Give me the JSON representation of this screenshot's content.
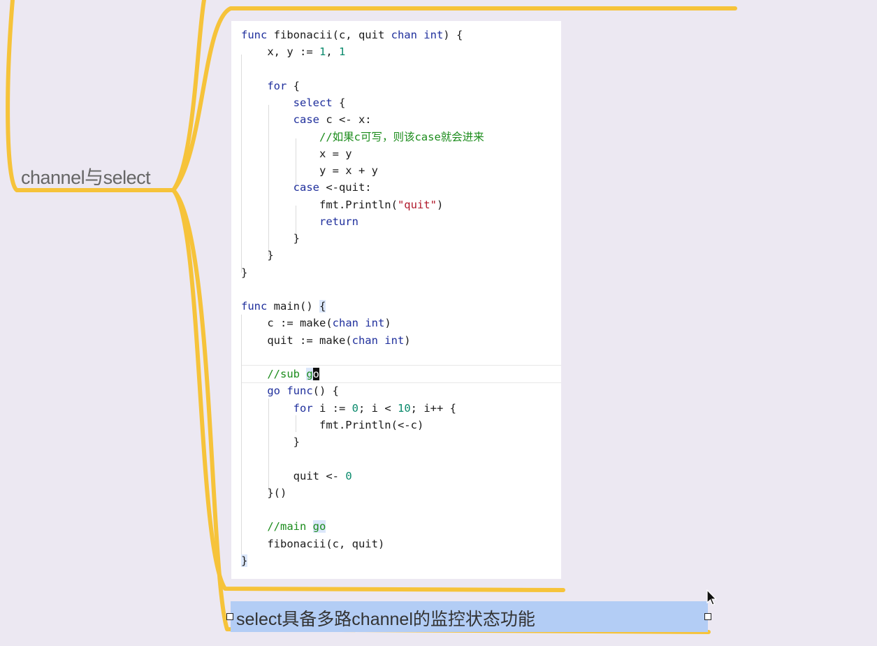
{
  "mindmap": {
    "root_label": "channel与select",
    "bottom_node_label": "select具备多路channel的监控状态功能",
    "branch_color": "#f6c33a"
  },
  "code": {
    "lines": [
      {
        "tokens": [
          {
            "k": "kw",
            "t": "func"
          },
          {
            "t": " fibonacii(c, quit "
          },
          {
            "k": "kw",
            "t": "chan int"
          },
          {
            "t": ") {"
          }
        ]
      },
      {
        "tokens": [
          {
            "t": "    x, y := "
          },
          {
            "k": "num",
            "t": "1"
          },
          {
            "t": ", "
          },
          {
            "k": "num",
            "t": "1"
          }
        ]
      },
      {
        "tokens": []
      },
      {
        "tokens": [
          {
            "t": "    "
          },
          {
            "k": "kw",
            "t": "for"
          },
          {
            "t": " {"
          }
        ]
      },
      {
        "tokens": [
          {
            "t": "        "
          },
          {
            "k": "kw",
            "t": "select"
          },
          {
            "t": " {"
          }
        ]
      },
      {
        "tokens": [
          {
            "t": "        "
          },
          {
            "k": "kw",
            "t": "case"
          },
          {
            "t": " c <- x:"
          }
        ]
      },
      {
        "tokens": [
          {
            "t": "            "
          },
          {
            "k": "cm",
            "t": "//如果c可写，则该case就会进来"
          }
        ]
      },
      {
        "tokens": [
          {
            "t": "            x = y"
          }
        ]
      },
      {
        "tokens": [
          {
            "t": "            y = x + y"
          }
        ]
      },
      {
        "tokens": [
          {
            "t": "        "
          },
          {
            "k": "kw",
            "t": "case"
          },
          {
            "t": " <-quit:"
          }
        ]
      },
      {
        "tokens": [
          {
            "t": "            fmt.Println("
          },
          {
            "k": "str",
            "t": "\"quit\""
          },
          {
            "t": ")"
          }
        ]
      },
      {
        "tokens": [
          {
            "t": "            "
          },
          {
            "k": "kw",
            "t": "return"
          }
        ]
      },
      {
        "tokens": [
          {
            "t": "        }"
          }
        ]
      },
      {
        "tokens": [
          {
            "t": "    }"
          }
        ]
      },
      {
        "tokens": [
          {
            "t": "}"
          }
        ]
      },
      {
        "tokens": []
      },
      {
        "tokens": [
          {
            "k": "kw",
            "t": "func"
          },
          {
            "t": " main() "
          },
          {
            "k": "hl",
            "t": "{"
          }
        ]
      },
      {
        "tokens": [
          {
            "t": "    c := make("
          },
          {
            "k": "kw",
            "t": "chan int"
          },
          {
            "t": ")"
          }
        ]
      },
      {
        "tokens": [
          {
            "t": "    quit := make("
          },
          {
            "k": "kw",
            "t": "chan int"
          },
          {
            "t": ")"
          }
        ]
      },
      {
        "tokens": []
      },
      {
        "tokens": [
          {
            "t": "    "
          },
          {
            "k": "cm",
            "t": "//sub "
          },
          {
            "k": "cm hl",
            "t": "g"
          },
          {
            "k": "cur",
            "t": "o"
          }
        ]
      },
      {
        "tokens": [
          {
            "t": "    "
          },
          {
            "k": "kw",
            "t": "go"
          },
          {
            "t": " "
          },
          {
            "k": "kw",
            "t": "func"
          },
          {
            "t": "() {"
          }
        ]
      },
      {
        "tokens": [
          {
            "t": "        "
          },
          {
            "k": "kw",
            "t": "for"
          },
          {
            "t": " i := "
          },
          {
            "k": "num",
            "t": "0"
          },
          {
            "t": "; i < "
          },
          {
            "k": "num",
            "t": "10"
          },
          {
            "t": "; i++ {"
          }
        ]
      },
      {
        "tokens": [
          {
            "t": "            fmt.Println(<-c)"
          }
        ]
      },
      {
        "tokens": [
          {
            "t": "        }"
          }
        ]
      },
      {
        "tokens": []
      },
      {
        "tokens": [
          {
            "t": "        quit <- "
          },
          {
            "k": "num",
            "t": "0"
          }
        ]
      },
      {
        "tokens": [
          {
            "t": "    }()"
          }
        ]
      },
      {
        "tokens": []
      },
      {
        "tokens": [
          {
            "t": "    "
          },
          {
            "k": "cm",
            "t": "//main "
          },
          {
            "k": "cm hl",
            "t": "go"
          }
        ]
      },
      {
        "tokens": [
          {
            "t": "    fibonacii(c, quit)"
          }
        ]
      },
      {
        "tokens": [
          {
            "k": "hl",
            "t": "}"
          }
        ]
      }
    ]
  }
}
